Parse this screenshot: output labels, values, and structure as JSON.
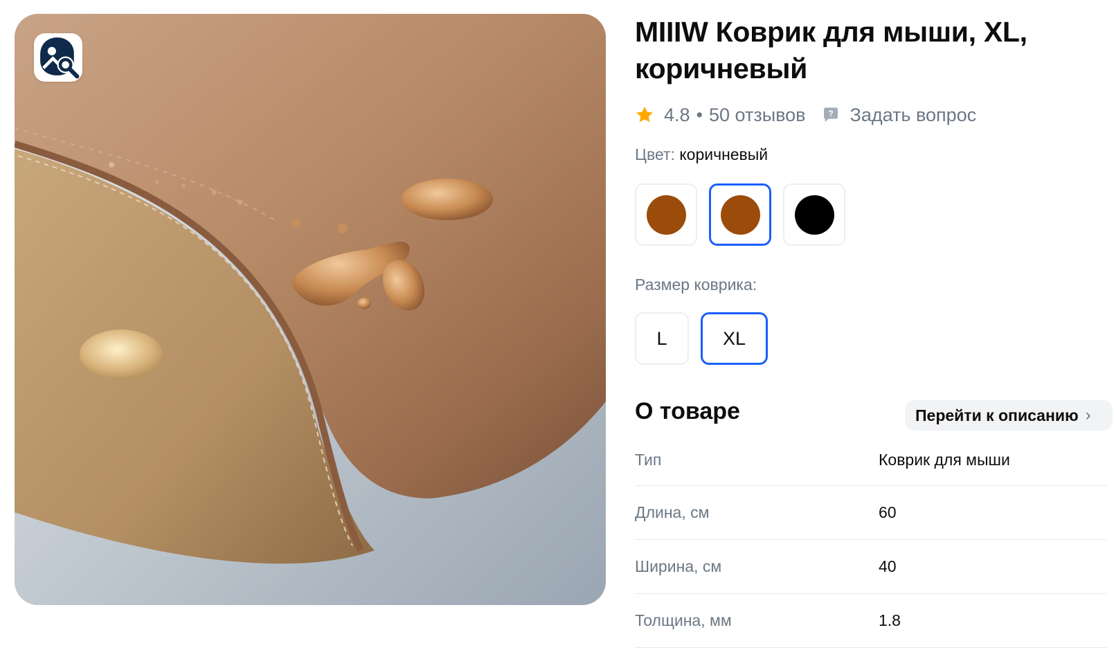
{
  "product": {
    "title": "MIIIW Коврик для мыши, XL, коричневый",
    "rating": "4.8",
    "separator": "•",
    "reviews": "50 отзывов",
    "ask_question": "Задать вопрос"
  },
  "color": {
    "label": "Цвет:",
    "selected": "коричневый",
    "options": [
      {
        "color": "#9b4b0a",
        "selected": false
      },
      {
        "color": "#9b4b0a",
        "selected": true
      },
      {
        "color": "#000000",
        "selected": false
      }
    ]
  },
  "size": {
    "label": "Размер коврика:",
    "options": [
      {
        "label": "L",
        "selected": false
      },
      {
        "label": "XL",
        "selected": true
      }
    ]
  },
  "about": {
    "title": "О товаре",
    "goto_description": "Перейти к описанию",
    "specs": [
      {
        "key": "Тип",
        "value": "Коврик для мыши"
      },
      {
        "key": "Длина, см",
        "value": "60"
      },
      {
        "key": "Ширина, см",
        "value": "40"
      },
      {
        "key": "Толщина, мм",
        "value": "1.8"
      }
    ]
  },
  "icons": {
    "image_search": "image-search-icon",
    "rating_star": "star-icon",
    "ask": "question-chat-icon",
    "chevron": "chevron-right-icon"
  },
  "colors": {
    "accent": "#1a5fff",
    "star": "#ffa800",
    "muted_text": "#6b7785"
  }
}
